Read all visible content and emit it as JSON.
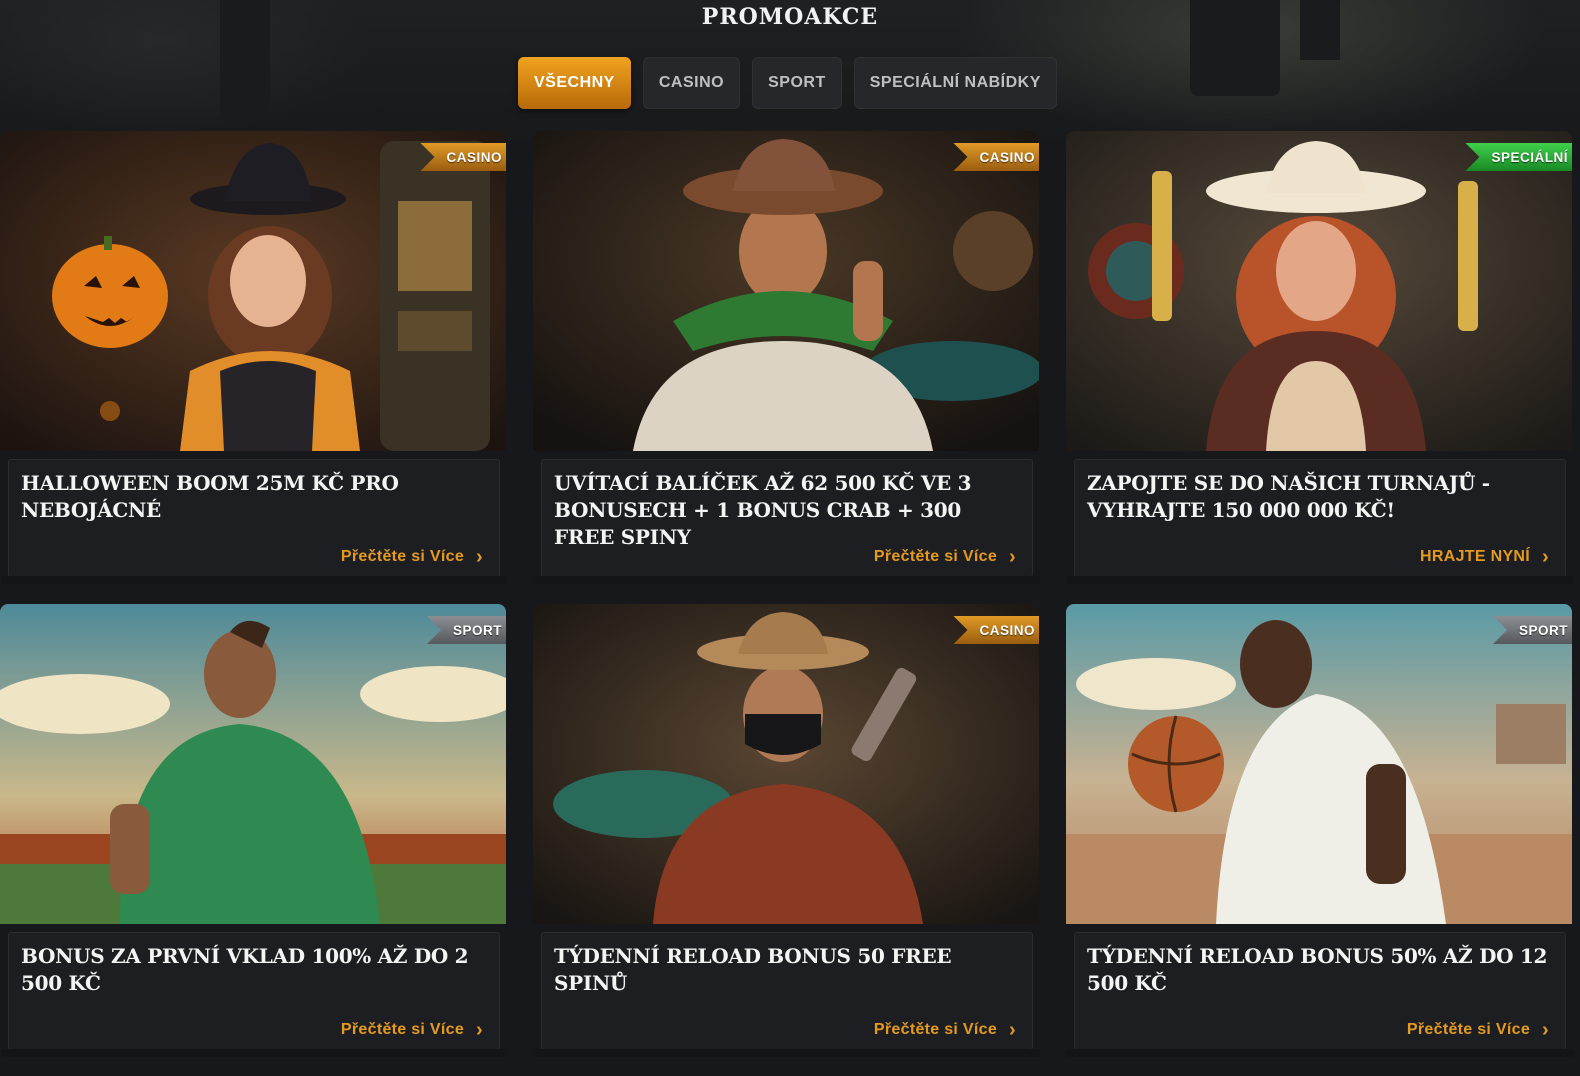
{
  "page": {
    "title": "PROMOAKCE"
  },
  "tabs": [
    {
      "label": "VŠECHNY",
      "active": true
    },
    {
      "label": "CASINO",
      "active": false
    },
    {
      "label": "SPORT",
      "active": false
    },
    {
      "label": "SPECIÁLNÍ NABÍDKY",
      "active": false
    }
  ],
  "colors": {
    "accent": "#e49a20",
    "badge_casino": "#d08a1c",
    "badge_sport": "#7a7d82",
    "badge_special": "#2fb23c",
    "background": "#16181b"
  },
  "promos": [
    {
      "badge": "CASINO",
      "badge_type": "casino",
      "title": "HALLOWEEN BOOM 25M KČ PRO NEBOJÁCNÉ",
      "link": "Přečtěte si Více",
      "image": "witch-with-pumpkin"
    },
    {
      "badge": "CASINO",
      "badge_type": "casino",
      "title": "UVÍTACÍ BALÍČEK AŽ 62 500 KČ VE 3 BONUSECH + 1 BONUS CRAB + 300 FREE SPINY",
      "link": "Přečtěte si Více",
      "image": "cowboy-green-scarf"
    },
    {
      "badge": "SPECIÁLNÍ",
      "badge_type": "special",
      "title": "ZAPOJTE SE DO NAŠICH TURNAJŮ - VYHRAJTE 150 000 000 KČ!",
      "link": "HRAJTE NYNÍ",
      "image": "cowgirl-revolvers"
    },
    {
      "badge": "SPORT",
      "badge_type": "sport",
      "title": "BONUS ZA PRVNÍ VKLAD 100% AŽ DO 2 500 KČ",
      "link": "Přečtěte si Více",
      "image": "soccer-player"
    },
    {
      "badge": "CASINO",
      "badge_type": "casino",
      "title": "TÝDENNÍ RELOAD BONUS 50 FREE SPINŮ",
      "link": "Přečtěte si Více",
      "image": "masked-bandit"
    },
    {
      "badge": "SPORT",
      "badge_type": "sport",
      "title": "TÝDENNÍ RELOAD BONUS 50% AŽ DO 12 500 KČ",
      "link": "Přečtěte si Více",
      "image": "basketball-player"
    }
  ]
}
